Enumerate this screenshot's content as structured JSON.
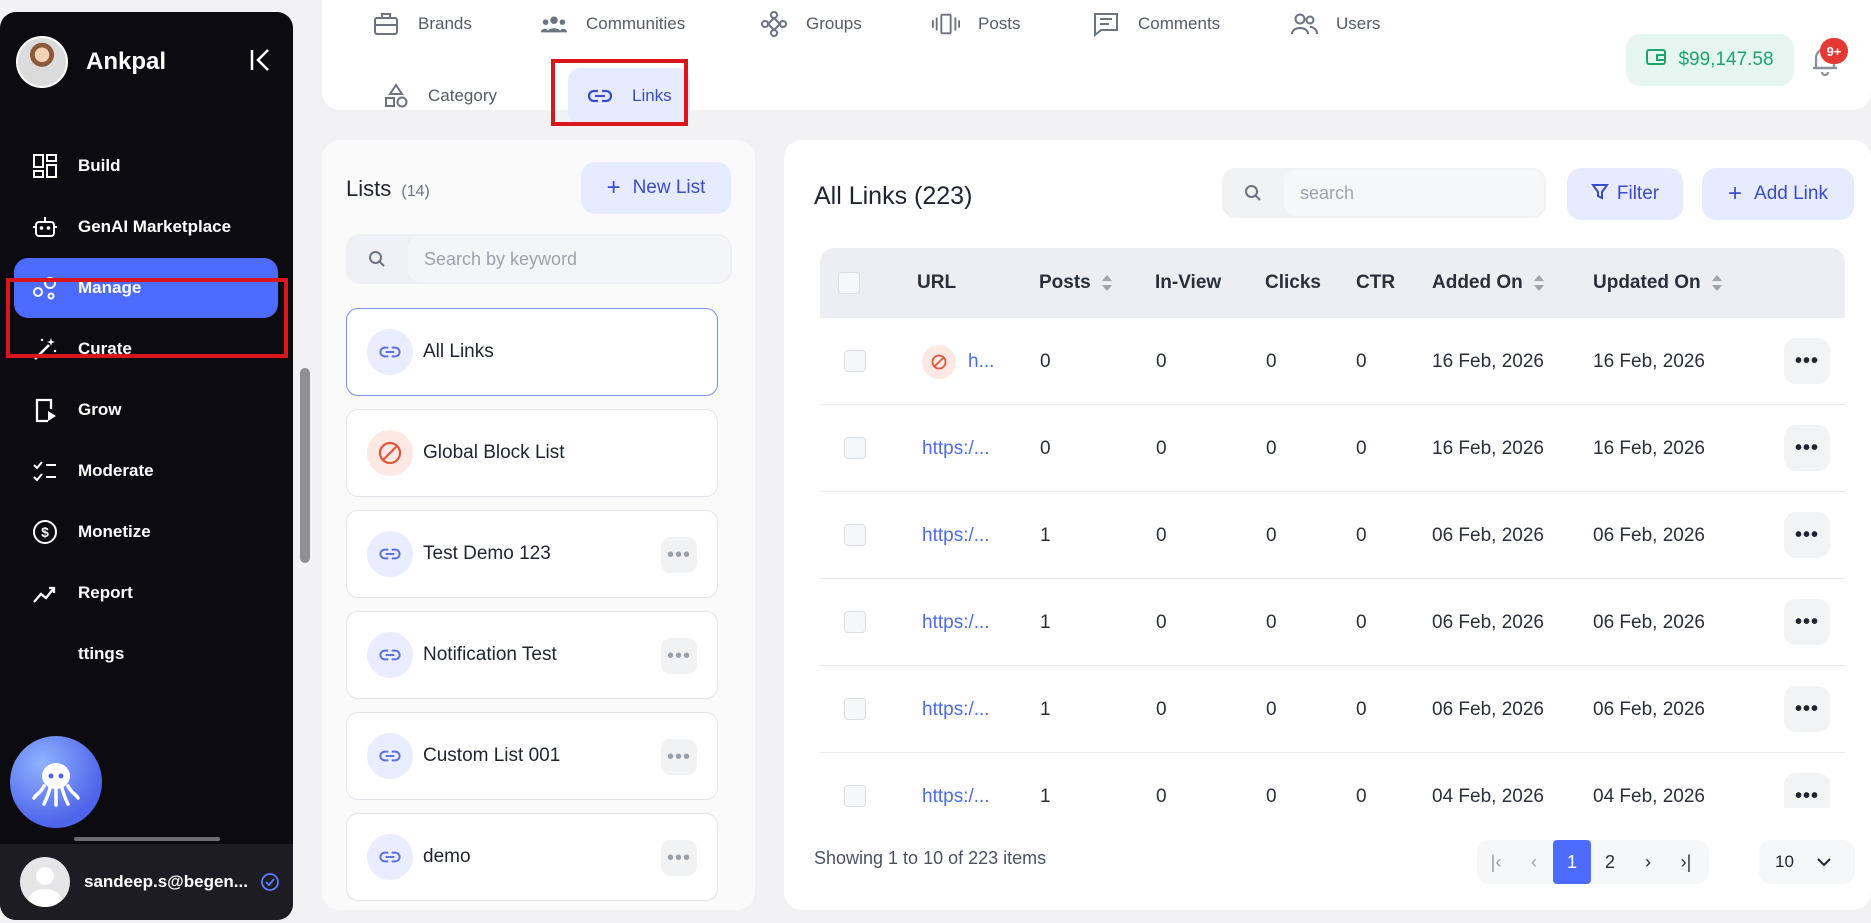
{
  "sidebar": {
    "brand": "Ankpal",
    "items": [
      {
        "label": "Build",
        "icon": "dashboard-grid-icon"
      },
      {
        "label": "GenAI Marketplace",
        "icon": "robot-icon"
      },
      {
        "label": "Manage",
        "icon": "manage-nodes-icon",
        "active": true
      },
      {
        "label": "Curate",
        "icon": "magic-wand-icon"
      },
      {
        "label": "Grow",
        "icon": "grow-play-icon"
      },
      {
        "label": "Moderate",
        "icon": "checklist-icon"
      },
      {
        "label": "Monetize",
        "icon": "dollar-circle-icon"
      },
      {
        "label": "Report",
        "icon": "trend-chart-icon"
      },
      {
        "label": "ttings",
        "icon": "gear-icon"
      }
    ],
    "user": {
      "email": "sandeep.s@begen..."
    }
  },
  "topbar": {
    "tabs": [
      {
        "label": "Brands",
        "icon": "briefcase-icon"
      },
      {
        "label": "Communities",
        "icon": "community-icon"
      },
      {
        "label": "Groups",
        "icon": "groups-icon"
      },
      {
        "label": "Posts",
        "icon": "posts-icon"
      },
      {
        "label": "Comments",
        "icon": "comment-icon"
      },
      {
        "label": "Users",
        "icon": "users-icon"
      },
      {
        "label": "Category",
        "icon": "shapes-icon"
      },
      {
        "label": "Links",
        "icon": "link-icon",
        "active": true
      }
    ],
    "wallet": "$99,147.58",
    "notification_badge": "9+"
  },
  "lists": {
    "title": "Lists",
    "count": "(14)",
    "new_list": "New List",
    "search_placeholder": "Search by keyword",
    "items": [
      {
        "name": "All Links",
        "active": true
      },
      {
        "name": "Global Block List",
        "blocked": true
      },
      {
        "name": "Test Demo 123"
      },
      {
        "name": "Notification Test"
      },
      {
        "name": "Custom List 001"
      },
      {
        "name": "demo"
      }
    ]
  },
  "links": {
    "title": "All Links (223)",
    "search_placeholder": "search",
    "filter": "Filter",
    "add_link": "Add Link",
    "columns": [
      "URL",
      "Posts",
      "In-View",
      "Clicks",
      "CTR",
      "Added On",
      "Updated On"
    ],
    "rows": [
      {
        "url": "h...",
        "blocked": true,
        "posts": "0",
        "inview": "0",
        "clicks": "0",
        "ctr": "0",
        "added": "16 Feb, 2026",
        "updated": "16 Feb, 2026"
      },
      {
        "url": "https:/...",
        "posts": "0",
        "inview": "0",
        "clicks": "0",
        "ctr": "0",
        "added": "16 Feb, 2026",
        "updated": "16 Feb, 2026"
      },
      {
        "url": "https:/...",
        "posts": "1",
        "inview": "0",
        "clicks": "0",
        "ctr": "0",
        "added": "06 Feb, 2026",
        "updated": "06 Feb, 2026"
      },
      {
        "url": "https:/...",
        "posts": "1",
        "inview": "0",
        "clicks": "0",
        "ctr": "0",
        "added": "06 Feb, 2026",
        "updated": "06 Feb, 2026"
      },
      {
        "url": "https:/...",
        "posts": "1",
        "inview": "0",
        "clicks": "0",
        "ctr": "0",
        "added": "06 Feb, 2026",
        "updated": "06 Feb, 2026"
      },
      {
        "url": "https:/...",
        "posts": "1",
        "inview": "0",
        "clicks": "0",
        "ctr": "0",
        "added": "04 Feb, 2026",
        "updated": "04 Feb, 2026"
      }
    ],
    "showing": "Showing 1 to 10 of 223 items",
    "pages": [
      "1",
      "2"
    ],
    "current_page": "1",
    "per_page": "10"
  },
  "colors": {
    "accent": "#4d6cff",
    "highlight_frame": "#d9161b",
    "wallet_green": "#21a36e"
  }
}
